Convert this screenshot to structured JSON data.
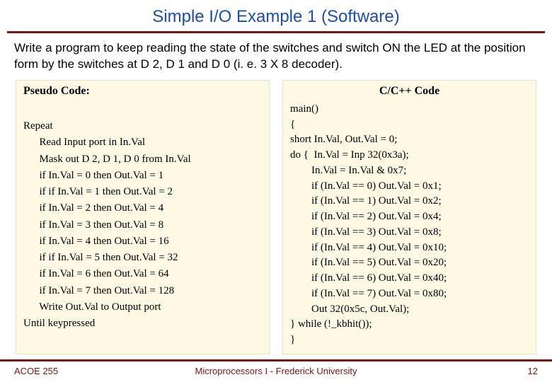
{
  "title": "Simple I/O Example 1 (Software)",
  "problem": "Write a program to keep reading the state of the switches and switch ON the LED at the position form by the switches at D 2, D 1 and D 0 (i. e. 3 X 8 decoder).",
  "left": {
    "heading": "Pseudo Code:",
    "lines": [
      "",
      "Repeat",
      "      Read Input port in In.Val",
      "      Mask out D 2, D 1, D 0 from In.Val",
      "      if In.Val = 0 then Out.Val = 1",
      "      if if In.Val = 1 then Out.Val = 2",
      "      if In.Val = 2 then Out.Val = 4",
      "      if In.Val = 3 then Out.Val = 8",
      "      if In.Val = 4 then Out.Val = 16",
      "      if if In.Val = 5 then Out.Val = 32",
      "      if In.Val = 6 then Out.Val = 64",
      "      if In.Val = 7 then Out.Val = 128",
      "      Write Out.Val to Output port",
      "Until keypressed"
    ]
  },
  "right": {
    "heading": "C/C++ Code",
    "lines": [
      "main()",
      "{",
      "short In.Val, Out.Val = 0;",
      "do {  In.Val = Inp 32(0x3a);",
      "        In.Val = In.Val & 0x7;",
      "        if (In.Val == 0) Out.Val = 0x1;",
      "        if (In.Val == 1) Out.Val = 0x2;",
      "        if (In.Val == 2) Out.Val = 0x4;",
      "        if (In.Val == 3) Out.Val = 0x8;",
      "        if (In.Val == 4) Out.Val = 0x10;",
      "        if (In.Val == 5) Out.Val = 0x20;",
      "        if (In.Val == 6) Out.Val = 0x40;",
      "        if (In.Val == 7) Out.Val = 0x80;",
      "        Out 32(0x5c, Out.Val);",
      "} while (!_kbhit());",
      "}"
    ]
  },
  "footer": {
    "left": "ACOE 255",
    "center": "Microprocessors I - Frederick University",
    "right": "12"
  }
}
